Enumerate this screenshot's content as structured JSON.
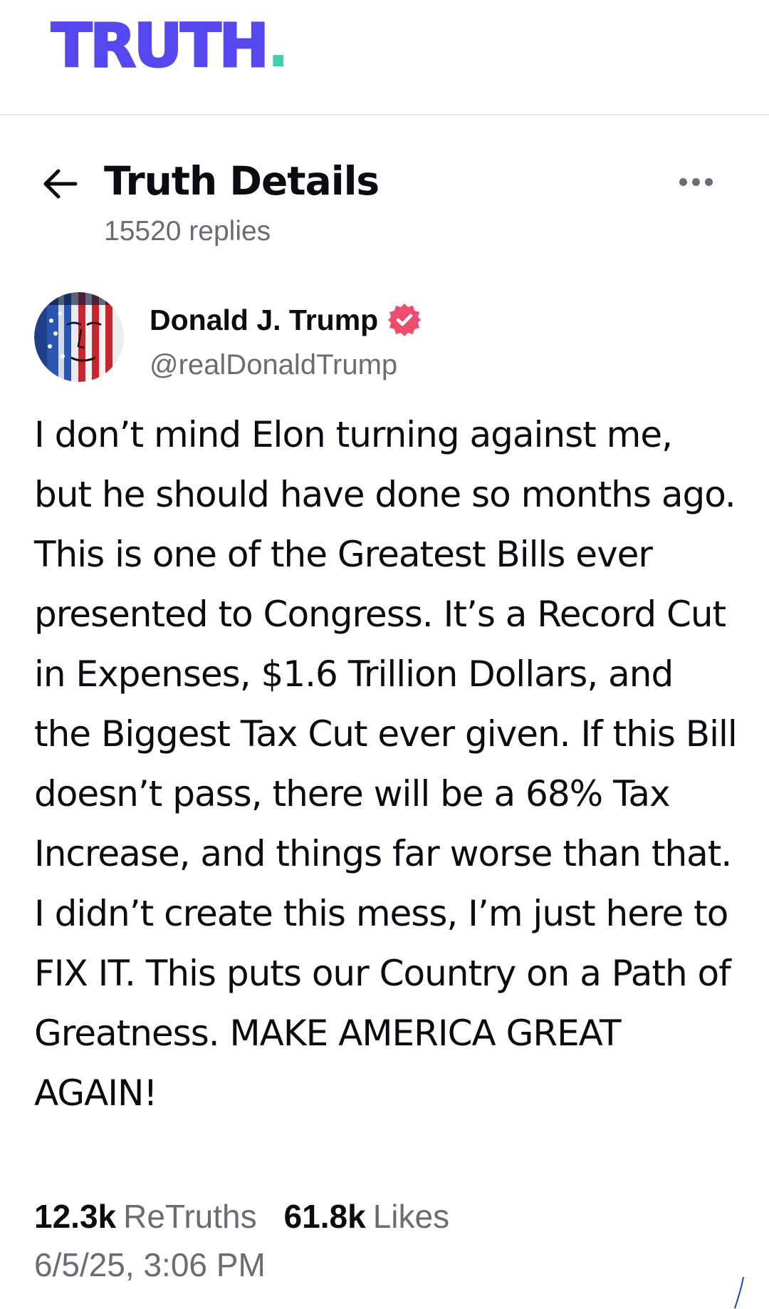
{
  "app": {
    "logo_text": "TRUTH",
    "logo_dot": ".",
    "logo_color": "#5448ee",
    "logo_dot_color": "#3ecfb0"
  },
  "header": {
    "back_icon": "arrow-left-icon",
    "title": "Truth Details",
    "replies": "15520 replies",
    "more_icon": "more-horizontal-icon"
  },
  "post": {
    "author_name": "Donald J. Trump",
    "verified_icon": "verified-badge-icon",
    "verified_color": "#ef4d6e",
    "handle": "@realDonaldTrump",
    "text": "I don’t mind Elon turning against me, but he should have done so months ago. This is one of the Greatest Bills ever presented to Congress. It’s a Record Cut in Expenses, $1.6 Trillion Dollars, and the Biggest Tax Cut ever given. If this Bill doesn’t pass, there will be a 68% Tax Increase, and things far worse than that. I didn’t create this mess, I’m just here to FIX IT. This puts our Country on a Path of Greatness. MAKE AMERICA GREAT AGAIN!",
    "retruths_count": "12.3k",
    "retruths_label": "ReTruths",
    "likes_count": "61.8k",
    "likes_label": "Likes",
    "timestamp": "6/5/25, 3:06 PM"
  }
}
